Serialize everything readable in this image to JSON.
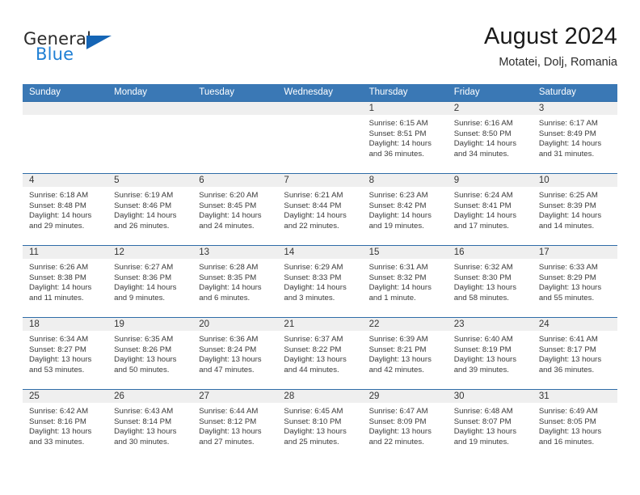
{
  "brand": {
    "name_part1": "General",
    "name_part2": "Blue"
  },
  "header": {
    "title": "August 2024",
    "subtitle": "Motatei, Dolj, Romania"
  },
  "colors": {
    "header_blue": "#3a78b5",
    "row_rule_blue": "#2f6ca8",
    "daynum_band": "#efefef",
    "brand_blue": "#1f7fd4"
  },
  "weekdays": [
    "Sunday",
    "Monday",
    "Tuesday",
    "Wednesday",
    "Thursday",
    "Friday",
    "Saturday"
  ],
  "weeks": [
    [
      {
        "day": "",
        "empty": true
      },
      {
        "day": "",
        "empty": true
      },
      {
        "day": "",
        "empty": true
      },
      {
        "day": "",
        "empty": true
      },
      {
        "day": "1",
        "sunrise": "Sunrise: 6:15 AM",
        "sunset": "Sunset: 8:51 PM",
        "daylight1": "Daylight: 14 hours",
        "daylight2": "and 36 minutes."
      },
      {
        "day": "2",
        "sunrise": "Sunrise: 6:16 AM",
        "sunset": "Sunset: 8:50 PM",
        "daylight1": "Daylight: 14 hours",
        "daylight2": "and 34 minutes."
      },
      {
        "day": "3",
        "sunrise": "Sunrise: 6:17 AM",
        "sunset": "Sunset: 8:49 PM",
        "daylight1": "Daylight: 14 hours",
        "daylight2": "and 31 minutes."
      }
    ],
    [
      {
        "day": "4",
        "sunrise": "Sunrise: 6:18 AM",
        "sunset": "Sunset: 8:48 PM",
        "daylight1": "Daylight: 14 hours",
        "daylight2": "and 29 minutes."
      },
      {
        "day": "5",
        "sunrise": "Sunrise: 6:19 AM",
        "sunset": "Sunset: 8:46 PM",
        "daylight1": "Daylight: 14 hours",
        "daylight2": "and 26 minutes."
      },
      {
        "day": "6",
        "sunrise": "Sunrise: 6:20 AM",
        "sunset": "Sunset: 8:45 PM",
        "daylight1": "Daylight: 14 hours",
        "daylight2": "and 24 minutes."
      },
      {
        "day": "7",
        "sunrise": "Sunrise: 6:21 AM",
        "sunset": "Sunset: 8:44 PM",
        "daylight1": "Daylight: 14 hours",
        "daylight2": "and 22 minutes."
      },
      {
        "day": "8",
        "sunrise": "Sunrise: 6:23 AM",
        "sunset": "Sunset: 8:42 PM",
        "daylight1": "Daylight: 14 hours",
        "daylight2": "and 19 minutes."
      },
      {
        "day": "9",
        "sunrise": "Sunrise: 6:24 AM",
        "sunset": "Sunset: 8:41 PM",
        "daylight1": "Daylight: 14 hours",
        "daylight2": "and 17 minutes."
      },
      {
        "day": "10",
        "sunrise": "Sunrise: 6:25 AM",
        "sunset": "Sunset: 8:39 PM",
        "daylight1": "Daylight: 14 hours",
        "daylight2": "and 14 minutes."
      }
    ],
    [
      {
        "day": "11",
        "sunrise": "Sunrise: 6:26 AM",
        "sunset": "Sunset: 8:38 PM",
        "daylight1": "Daylight: 14 hours",
        "daylight2": "and 11 minutes."
      },
      {
        "day": "12",
        "sunrise": "Sunrise: 6:27 AM",
        "sunset": "Sunset: 8:36 PM",
        "daylight1": "Daylight: 14 hours",
        "daylight2": "and 9 minutes."
      },
      {
        "day": "13",
        "sunrise": "Sunrise: 6:28 AM",
        "sunset": "Sunset: 8:35 PM",
        "daylight1": "Daylight: 14 hours",
        "daylight2": "and 6 minutes."
      },
      {
        "day": "14",
        "sunrise": "Sunrise: 6:29 AM",
        "sunset": "Sunset: 8:33 PM",
        "daylight1": "Daylight: 14 hours",
        "daylight2": "and 3 minutes."
      },
      {
        "day": "15",
        "sunrise": "Sunrise: 6:31 AM",
        "sunset": "Sunset: 8:32 PM",
        "daylight1": "Daylight: 14 hours",
        "daylight2": "and 1 minute."
      },
      {
        "day": "16",
        "sunrise": "Sunrise: 6:32 AM",
        "sunset": "Sunset: 8:30 PM",
        "daylight1": "Daylight: 13 hours",
        "daylight2": "and 58 minutes."
      },
      {
        "day": "17",
        "sunrise": "Sunrise: 6:33 AM",
        "sunset": "Sunset: 8:29 PM",
        "daylight1": "Daylight: 13 hours",
        "daylight2": "and 55 minutes."
      }
    ],
    [
      {
        "day": "18",
        "sunrise": "Sunrise: 6:34 AM",
        "sunset": "Sunset: 8:27 PM",
        "daylight1": "Daylight: 13 hours",
        "daylight2": "and 53 minutes."
      },
      {
        "day": "19",
        "sunrise": "Sunrise: 6:35 AM",
        "sunset": "Sunset: 8:26 PM",
        "daylight1": "Daylight: 13 hours",
        "daylight2": "and 50 minutes."
      },
      {
        "day": "20",
        "sunrise": "Sunrise: 6:36 AM",
        "sunset": "Sunset: 8:24 PM",
        "daylight1": "Daylight: 13 hours",
        "daylight2": "and 47 minutes."
      },
      {
        "day": "21",
        "sunrise": "Sunrise: 6:37 AM",
        "sunset": "Sunset: 8:22 PM",
        "daylight1": "Daylight: 13 hours",
        "daylight2": "and 44 minutes."
      },
      {
        "day": "22",
        "sunrise": "Sunrise: 6:39 AM",
        "sunset": "Sunset: 8:21 PM",
        "daylight1": "Daylight: 13 hours",
        "daylight2": "and 42 minutes."
      },
      {
        "day": "23",
        "sunrise": "Sunrise: 6:40 AM",
        "sunset": "Sunset: 8:19 PM",
        "daylight1": "Daylight: 13 hours",
        "daylight2": "and 39 minutes."
      },
      {
        "day": "24",
        "sunrise": "Sunrise: 6:41 AM",
        "sunset": "Sunset: 8:17 PM",
        "daylight1": "Daylight: 13 hours",
        "daylight2": "and 36 minutes."
      }
    ],
    [
      {
        "day": "25",
        "sunrise": "Sunrise: 6:42 AM",
        "sunset": "Sunset: 8:16 PM",
        "daylight1": "Daylight: 13 hours",
        "daylight2": "and 33 minutes."
      },
      {
        "day": "26",
        "sunrise": "Sunrise: 6:43 AM",
        "sunset": "Sunset: 8:14 PM",
        "daylight1": "Daylight: 13 hours",
        "daylight2": "and 30 minutes."
      },
      {
        "day": "27",
        "sunrise": "Sunrise: 6:44 AM",
        "sunset": "Sunset: 8:12 PM",
        "daylight1": "Daylight: 13 hours",
        "daylight2": "and 27 minutes."
      },
      {
        "day": "28",
        "sunrise": "Sunrise: 6:45 AM",
        "sunset": "Sunset: 8:10 PM",
        "daylight1": "Daylight: 13 hours",
        "daylight2": "and 25 minutes."
      },
      {
        "day": "29",
        "sunrise": "Sunrise: 6:47 AM",
        "sunset": "Sunset: 8:09 PM",
        "daylight1": "Daylight: 13 hours",
        "daylight2": "and 22 minutes."
      },
      {
        "day": "30",
        "sunrise": "Sunrise: 6:48 AM",
        "sunset": "Sunset: 8:07 PM",
        "daylight1": "Daylight: 13 hours",
        "daylight2": "and 19 minutes."
      },
      {
        "day": "31",
        "sunrise": "Sunrise: 6:49 AM",
        "sunset": "Sunset: 8:05 PM",
        "daylight1": "Daylight: 13 hours",
        "daylight2": "and 16 minutes."
      }
    ]
  ]
}
